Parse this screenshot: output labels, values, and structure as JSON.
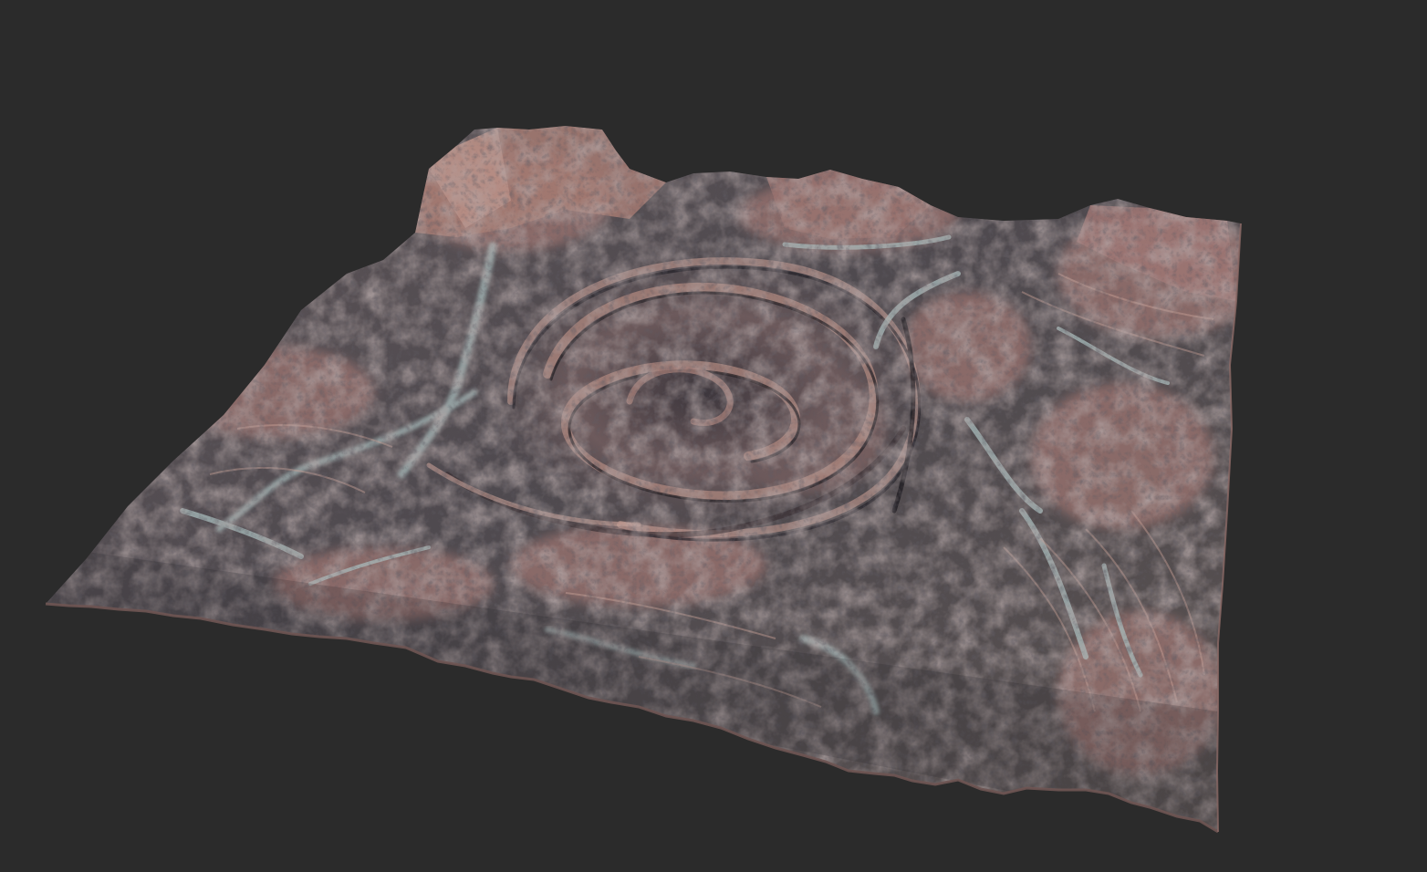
{
  "viewport": {
    "background_color": "#2b2b2b",
    "subject": "terrain-heightfield",
    "palette": {
      "rock_dark": "#3f3f45",
      "rock_mid": "#5a5356",
      "rock_pink": "#b18479",
      "rock_pink_light": "#caa096",
      "wash_light": "#a9bcbc",
      "shadow": "#25232a"
    }
  }
}
